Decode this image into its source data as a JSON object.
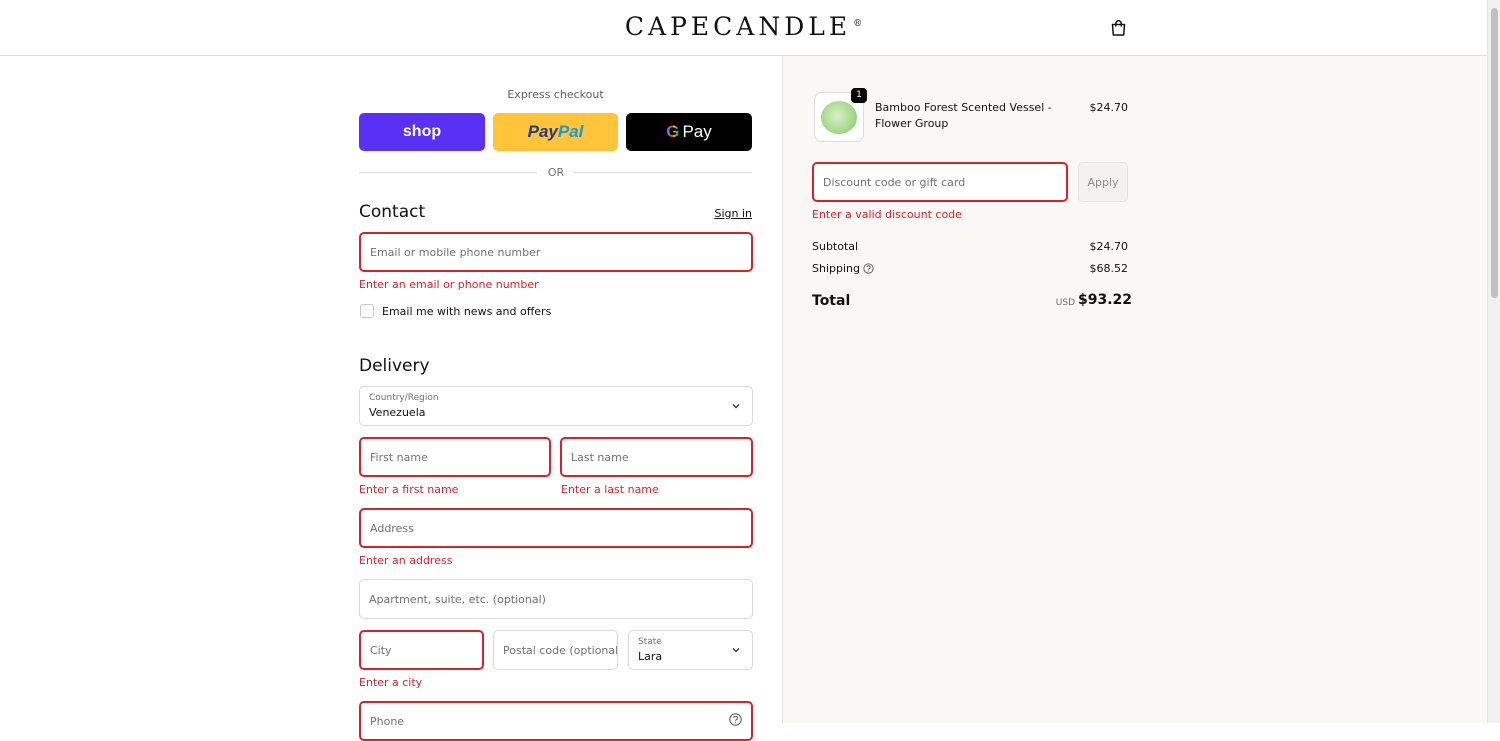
{
  "header": {
    "brand": "CAPECANDLE",
    "brand_mark": "®",
    "cart_icon": "shopping-bag-icon"
  },
  "express": {
    "label": "Express checkout",
    "shop_label": "shop",
    "paypal_part1": "Pay",
    "paypal_part2": "Pal",
    "gpay_g": "G",
    "gpay_label": "Pay",
    "or_label": "OR"
  },
  "contact": {
    "title": "Contact",
    "sign_in": "Sign in",
    "email_placeholder": "Email or mobile phone number",
    "email_error": "Enter an email or phone number",
    "newsletter_label": "Email me with news and offers"
  },
  "delivery": {
    "title": "Delivery",
    "country_caption": "Country/Region",
    "country_value": "Venezuela",
    "first_name_placeholder": "First name",
    "first_name_error": "Enter a first name",
    "last_name_placeholder": "Last name",
    "last_name_error": "Enter a last name",
    "address_placeholder": "Address",
    "address_error": "Enter an address",
    "apartment_placeholder": "Apartment, suite, etc. (optional)",
    "city_placeholder": "City",
    "city_error": "Enter a city",
    "postal_placeholder": "Postal code (optional)",
    "state_caption": "State",
    "state_value": "Lara",
    "phone_placeholder": "Phone"
  },
  "summary": {
    "item": {
      "quantity": "1",
      "name": "Bamboo Forest Scented Vessel - Flower Group",
      "price": "$24.70"
    },
    "discount_placeholder": "Discount code or gift card",
    "apply_label": "Apply",
    "discount_error": "Enter a valid discount code",
    "subtotal_label": "Subtotal",
    "subtotal_value": "$24.70",
    "shipping_label": "Shipping",
    "shipping_value": "$68.52",
    "total_label": "Total",
    "currency": "USD",
    "total_value": "$93.22"
  },
  "colors": {
    "error": "#d3242c",
    "shop_pay": "#5a31f4",
    "paypal": "#ffc439",
    "summary_bg": "#faf8f5"
  }
}
